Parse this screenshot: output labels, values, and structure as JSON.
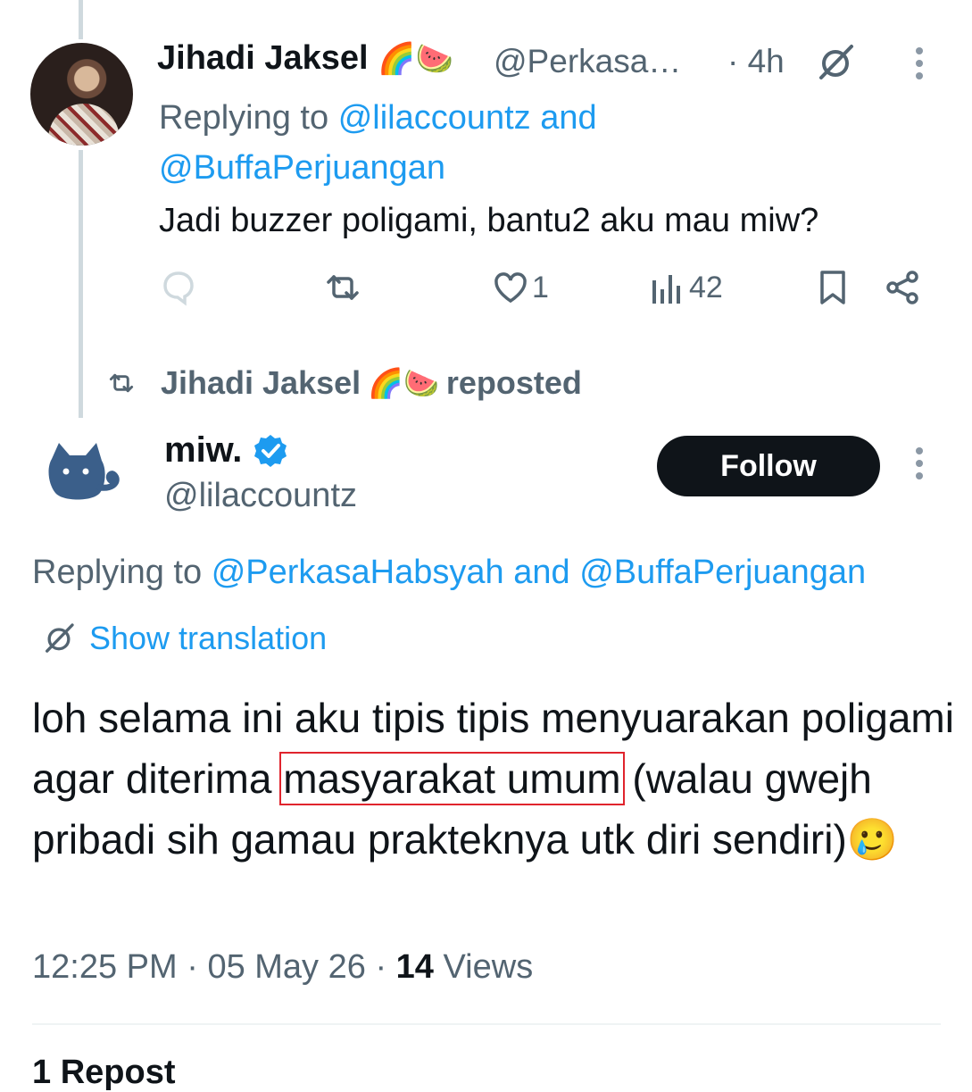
{
  "parent_tweet": {
    "author_name": "Jihadi Jaksel",
    "author_emojis": "🌈🍉",
    "handle": "@Perkasa…",
    "time": "· 4h",
    "replying_prefix": "Replying to",
    "replying_handle_1": "@lilaccountz",
    "replying_and": "and",
    "replying_handle_2": "@BuffaPerjuangan",
    "text": "Jadi buzzer poligami, bantu2 aku mau miw?",
    "like_count": "1",
    "view_count": "42"
  },
  "repost_banner": {
    "name": "Jihadi Jaksel",
    "emojis": "🌈🍉",
    "label": "reposted"
  },
  "main_tweet": {
    "author_name": "miw.",
    "handle": "@lilaccountz",
    "follow_label": "Follow",
    "replying_prefix": "Replying to",
    "replying_handle_1": "@PerkasaHabsyah",
    "replying_and": "and",
    "replying_handle_2": "@BuffaPerjuangan",
    "show_translation": "Show translation",
    "text_before": "loh selama ini aku tipis tipis menyuarakan poligami agar diterima ",
    "text_highlight": "masyarakat umum",
    "text_after": " (walau gwejh pribadi sih gamau prakteknya utk diri sendiri)",
    "text_emoji": "🥲",
    "time": "12:25 PM",
    "date": "05 May 26",
    "views_count": "14",
    "views_label": "Views"
  },
  "footer_cut_text": "1 Repost",
  "colors": {
    "accent": "#1d9bf0",
    "secondary_text": "#536471",
    "highlight_box": "#e0242d",
    "button_bg": "#0f1419"
  }
}
